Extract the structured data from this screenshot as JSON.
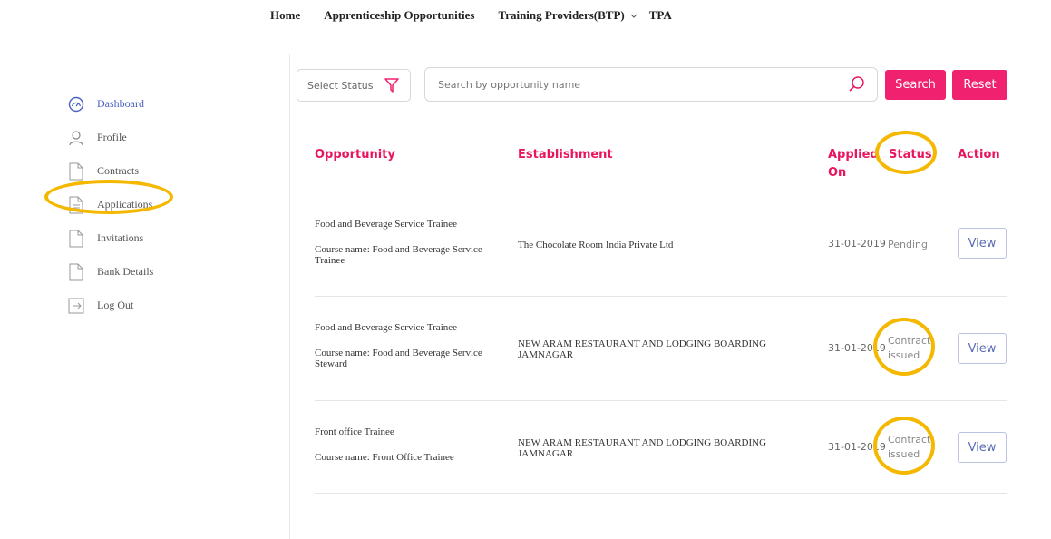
{
  "nav": {
    "home": "Home",
    "apprenticeship": "Apprenticeship Opportunities",
    "training_providers": "Training Providers(BTP)",
    "tpa": "TPA"
  },
  "sidebar": {
    "items": [
      {
        "label": "Dashboard",
        "icon": "dashboard-gauge-icon",
        "active": true
      },
      {
        "label": "Profile",
        "icon": "user-icon"
      },
      {
        "label": "Contracts",
        "icon": "document-icon"
      },
      {
        "label": "Applications",
        "icon": "document-lines-icon"
      },
      {
        "label": "Invitations",
        "icon": "document-icon"
      },
      {
        "label": "Bank Details",
        "icon": "document-icon"
      },
      {
        "label": "Log Out",
        "icon": "logout-icon"
      }
    ]
  },
  "filters": {
    "status_placeholder": "Select Status",
    "search_placeholder": "Search by opportunity name",
    "search_button": "Search",
    "reset_button": "Reset"
  },
  "table": {
    "headers": {
      "opportunity": "Opportunity",
      "establishment": "Establishment",
      "applied_on_1": "Applied",
      "applied_on_2": "On",
      "status": "Status",
      "action": "Action"
    },
    "rows": [
      {
        "opportunity": "Food and Beverage Service Trainee",
        "course": "Course name: Food and Beverage Service Trainee",
        "establishment": "The Chocolate Room India Private Ltd",
        "applied_on": "31-01-2019",
        "status_1": "Pending",
        "status_2": "",
        "action": "View"
      },
      {
        "opportunity": "Food and Beverage Service Trainee",
        "course": "Course name: Food and Beverage Service Steward",
        "establishment": "NEW ARAM RESTAURANT AND LODGING BOARDING JAMNAGAR",
        "applied_on": "31-01-2019",
        "status_1": "Contract",
        "status_2": "issued",
        "action": "View"
      },
      {
        "opportunity": "Front office Trainee",
        "course": "Course name: Front Office Trainee",
        "establishment": "NEW ARAM RESTAURANT AND LODGING BOARDING JAMNAGAR",
        "applied_on": "31-01-2019",
        "status_1": "Contract",
        "status_2": "issued",
        "action": "View"
      }
    ]
  },
  "colors": {
    "accent": "#f0216e",
    "header_text": "#e9165f",
    "active_nav": "#4a5fc1",
    "highlight_ring": "#f5b800"
  }
}
